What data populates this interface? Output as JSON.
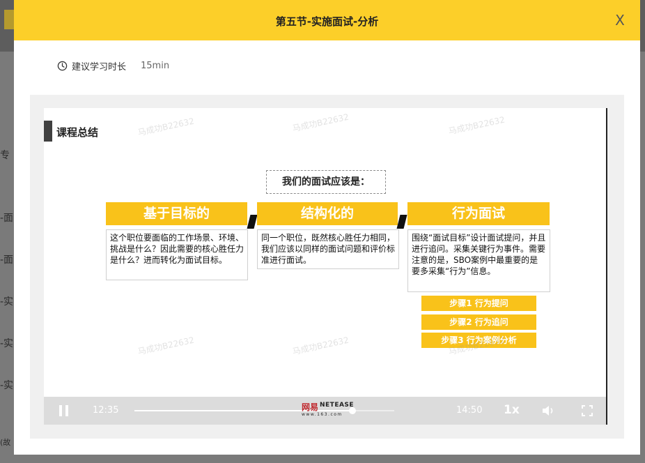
{
  "modal": {
    "title": "第五节-实施面试-分析",
    "close_label": "X"
  },
  "study": {
    "label": "建议学习时长",
    "value": "15min",
    "icon": "clock-icon"
  },
  "slide": {
    "summary_title": "课程总结",
    "question": "我们的面试应该是：",
    "columns": [
      {
        "head": "基于目标的",
        "body": "这个职位要面临的工作场景、环境、挑战是什么？因此需要的核心胜任力是什么？进而转化为面试目标。"
      },
      {
        "head": "结构化的",
        "body": "同一个职位，既然核心胜任力相同，我们应该以同样的面试问题和评价标准进行面试。"
      },
      {
        "head": "行为面试",
        "body": "围绕“面试目标”设计面试提问，并且进行追问。采集关键行为事件。需要注意的是，SBO案例中最重要的是要多采集“行为”信息。"
      }
    ],
    "steps": [
      "步骤1 行为提问",
      "步骤2 行为追问",
      "步骤3 行为案例分析"
    ],
    "watermark": "马成功B22632"
  },
  "player": {
    "current_time": "12:35",
    "total_time": "14:50",
    "progress": 0.84,
    "speed": "1x",
    "brand_main": "网易",
    "brand_sub": "NETEASE",
    "brand_url": "www.163.com"
  },
  "background": {
    "items": [
      "专",
      "-面",
      "-面",
      "-实",
      "-实",
      "-实"
    ],
    "bottom_text": "(故"
  },
  "colors": {
    "header": "#fccf29",
    "accent": "#f9c21a"
  }
}
